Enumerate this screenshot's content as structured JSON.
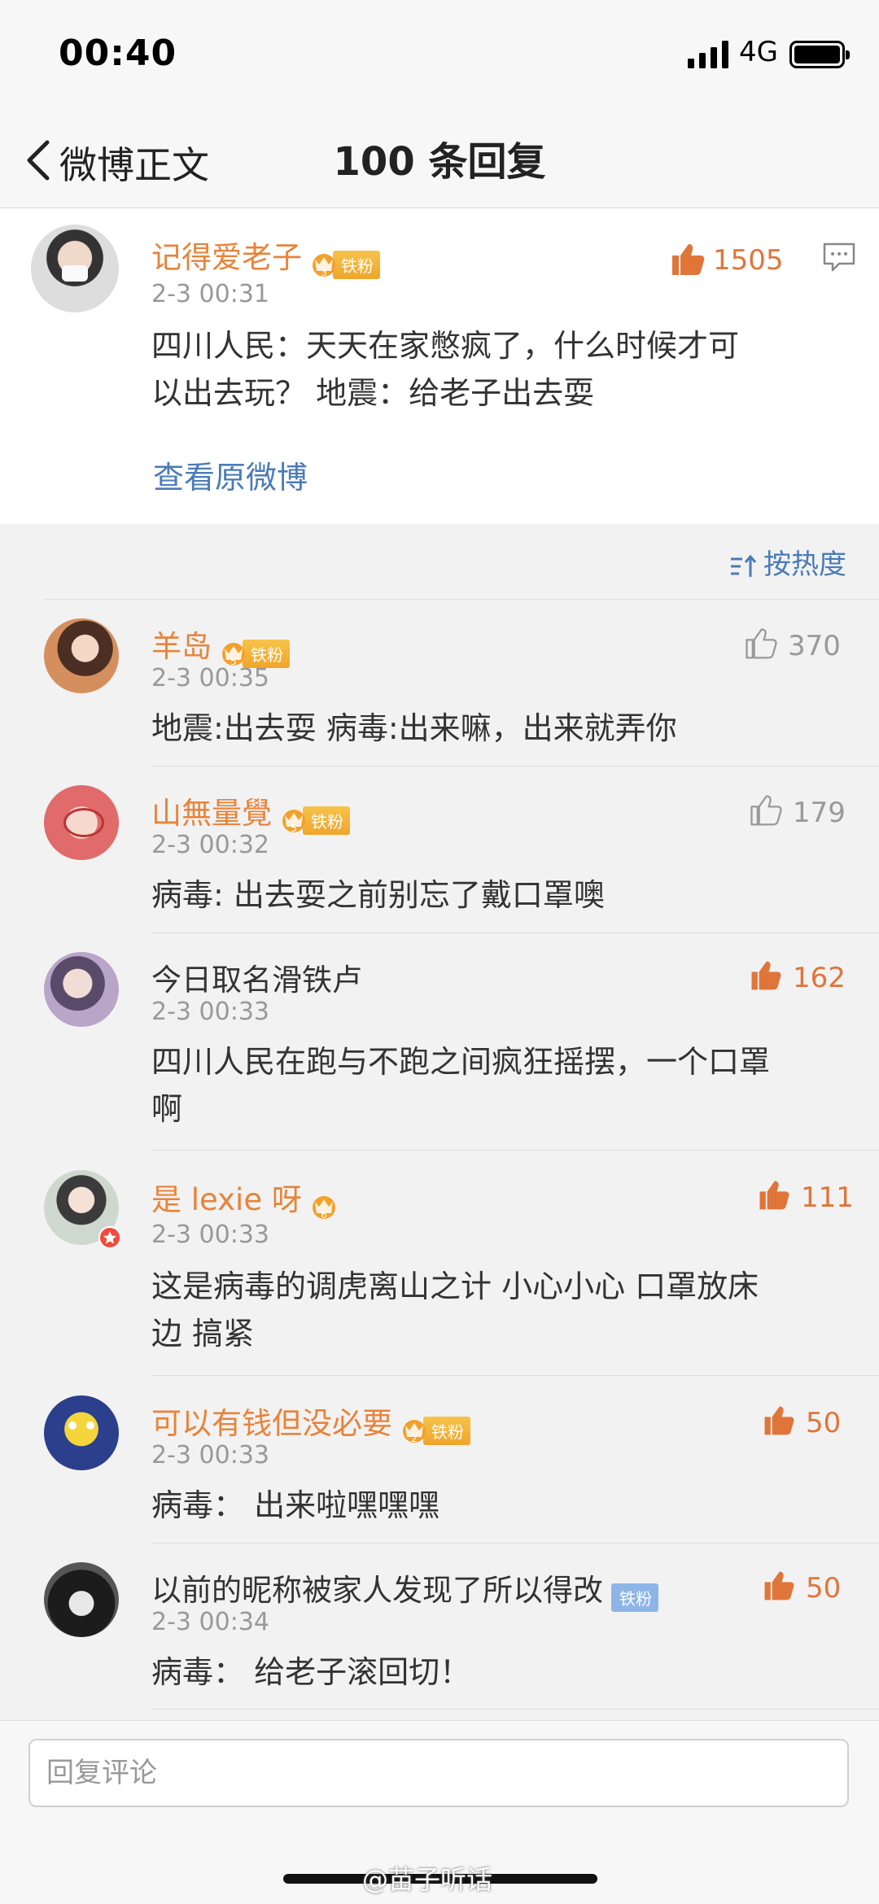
{
  "status": {
    "time": "00:40",
    "network": "4G"
  },
  "nav": {
    "back_label": "微博正文",
    "title": "100 条回复"
  },
  "main_comment": {
    "username": "记得爱老子",
    "badge_level": "3",
    "badge_text": "铁粉",
    "time": "2-3 00:31",
    "likes": "1505",
    "text_line1": "四川人民：天天在家憋疯了，什么时候才可",
    "text_line2": "以出去玩？ 地震：给老子出去耍",
    "view_original": "查看原微博"
  },
  "sort_label": "按热度",
  "replies": [
    {
      "username": "羊岛",
      "badge_level": "5",
      "badge_text": "铁粉",
      "time": "2-3 00:35",
      "likes": "370",
      "text_line1": "地震:出去耍  病毒:出来嘛，出来就弄你",
      "text_line2": ""
    },
    {
      "username": "山無量覺",
      "badge_level": "5",
      "badge_text": "铁粉",
      "time": "2-3 00:32",
      "likes": "179",
      "text_line1": "病毒: 出去耍之前别忘了戴口罩噢",
      "text_line2": ""
    },
    {
      "username": "今日取名滑铁卢",
      "time": "2-3 00:33",
      "likes": "162",
      "text_line1": "四川人民在跑与不跑之间疯狂摇摆，一个口罩",
      "text_line2": "啊"
    },
    {
      "username": "是 lexie 呀",
      "badge_level": "6",
      "time": "2-3 00:33",
      "likes": "111",
      "text_line1": "这是病毒的调虎离山之计 小心小心 口罩放床",
      "text_line2": "边 搞紧"
    },
    {
      "username": "可以有钱但没必要",
      "badge_level": "2",
      "badge_text": "铁粉",
      "time": "2-3 00:33",
      "likes": "50",
      "text_line1": "病毒： 出来啦嘿嘿嘿",
      "text_line2": ""
    },
    {
      "username": "以前的昵称被家人发现了所以得改",
      "badge_text": "铁粉",
      "time": "2-3 00:34",
      "likes": "50",
      "text_line1": "病毒： 给老子滚回切！",
      "text_line2": ""
    }
  ],
  "footer": {
    "input_placeholder": "回复评论",
    "watermark": "@苗子听话"
  },
  "colors": {
    "username": "#e8833a",
    "link": "#4a7bb8",
    "like_active": "#e0753a",
    "muted": "#999999"
  },
  "icons": [
    "back-chevron-icon",
    "thumbs-up-icon",
    "comment-icon",
    "sort-icon",
    "crown-icon",
    "verified-icon"
  ]
}
